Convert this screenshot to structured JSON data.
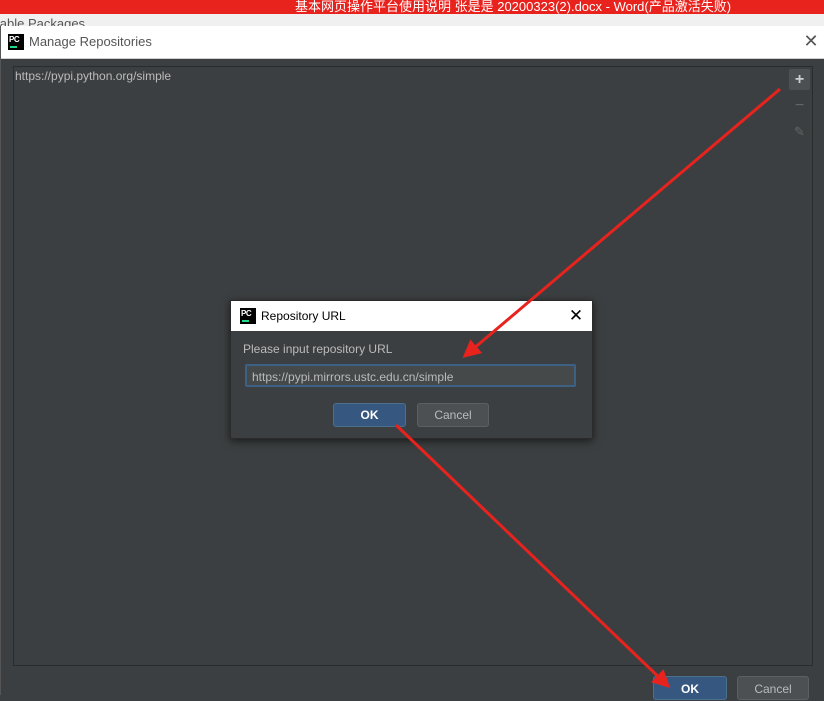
{
  "background": {
    "word_title": "基本网页操作平台使用说明 张是是 20200323(2).docx - Word(产品激活失败)",
    "behind_label": "ilable Packages"
  },
  "manage_window": {
    "title": "Manage Repositories",
    "close_glyph": "✕",
    "repositories": [
      "https://pypi.python.org/simple"
    ],
    "toolbar": {
      "add": "+",
      "remove": "−",
      "edit": "✎"
    },
    "ok_label": "OK",
    "cancel_label": "Cancel"
  },
  "url_dialog": {
    "title": "Repository URL",
    "close_glyph": "✕",
    "prompt": "Please input repository URL",
    "input_value": "https://pypi.mirrors.ustc.edu.cn/simple",
    "ok_label": "OK",
    "cancel_label": "Cancel"
  },
  "logo_text": "PC",
  "colors": {
    "arrow": "#e8231e",
    "accent_button": "#365880",
    "panel_bg": "#3c3f41"
  },
  "icons": [
    "pycharm-logo-icon",
    "close-icon",
    "add-icon",
    "remove-icon",
    "edit-icon"
  ]
}
